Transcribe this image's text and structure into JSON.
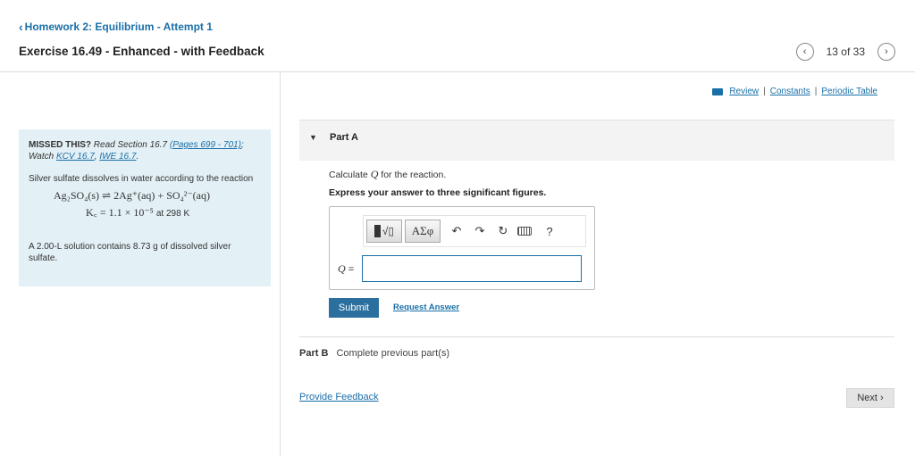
{
  "header": {
    "back_link": "Homework 2: Equilibrium - Attempt 1",
    "exercise_title": "Exercise 16.49 - Enhanced - with Feedback",
    "pager_count": "13 of 33"
  },
  "links": {
    "review": "Review",
    "constants": "Constants",
    "periodic_table": "Periodic Table",
    "separator": "|"
  },
  "info": {
    "missed_label": "MISSED THIS?",
    "read_section": "Read Section 16.7",
    "pages_link": "(Pages 699 - 701)",
    "semicolon": ";",
    "watch": "Watch",
    "kcv_link": "KCV 16.7",
    "comma": ",",
    "iwe_link": "IWE 16.7",
    "period": ".",
    "description": "Silver sulfate dissolves in water according to the reaction",
    "equation_left": "Ag₂SO₄(s)",
    "equation_arrow": "⇌",
    "equation_right": "2Ag⁺(aq) + SO₄²⁻(aq)",
    "kc_expression": "K꜀ = 1.1 × 10⁻⁵",
    "kc_tail": "at 298 K",
    "solution_text": "A 2.00-L solution contains 8.73 g of dissolved silver sulfate."
  },
  "part_a": {
    "label": "Part A",
    "calc_prefix": "Calculate",
    "calc_q": "Q",
    "calc_suffix": "for the reaction.",
    "express": "Express your answer to three significant figures.",
    "greek_button": "ΑΣφ",
    "help_button": "?",
    "q_label": "Q",
    "q_equals": "=",
    "input_value": "",
    "submit": "Submit",
    "request_answer": "Request Answer"
  },
  "part_b": {
    "label": "Part B",
    "status": "Complete previous part(s)"
  },
  "footer": {
    "feedback": "Provide Feedback",
    "next": "Next"
  },
  "icons": {
    "back": "chevron-left-icon",
    "prev": "chevron-left-icon",
    "next": "chevron-right-icon",
    "undo": "undo-icon",
    "redo": "redo-icon",
    "reset": "reset-icon",
    "keyboard": "keyboard-icon",
    "book": "book-icon"
  },
  "colors": {
    "link": "#1a6fa8",
    "submit_bg": "#2b6f9e",
    "info_bg": "#e3f0f5",
    "part_header_bg": "#f3f3f3",
    "next_bg": "#e4e4e4"
  }
}
